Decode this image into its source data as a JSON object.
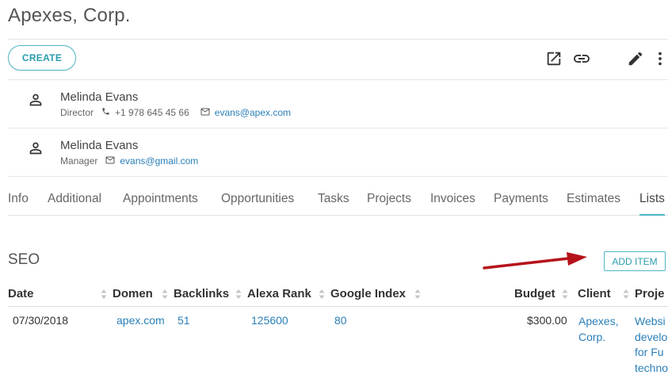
{
  "header": {
    "title": "Apexes, Corp."
  },
  "toolbar": {
    "create_label": "CREATE",
    "icons": [
      "open-external-icon",
      "link-icon",
      "edit-pencil-icon",
      "more-vert-icon"
    ]
  },
  "contacts": [
    {
      "name": "Melinda Evans",
      "role": "Director",
      "phone": "+1 978 645 45 66",
      "email": "evans@apex.com"
    },
    {
      "name": "Melinda Evans",
      "role": "Manager",
      "email": "evans@gmail.com"
    }
  ],
  "tabs": [
    "Info",
    "Additional",
    "Appointments",
    "Opportunities",
    "Tasks",
    "Projects",
    "Invoices",
    "Payments",
    "Estimates",
    "Lists"
  ],
  "active_tab": "Lists",
  "list": {
    "title": "SEO",
    "add_item_label": "ADD ITEM",
    "columns": [
      "Date",
      "Domen",
      "Backlinks",
      "Alexa Rank",
      "Google Index",
      "Budget",
      "Client",
      "Proje"
    ],
    "rows": [
      {
        "date": "07/30/2018",
        "domen": "apex.com",
        "backlinks": "51",
        "alexa_rank": "125600",
        "google_index": "80",
        "budget": "$300.00",
        "client_line1": "Apexes,",
        "client_line2": "Corp.",
        "project_lines": [
          "Websi",
          "develo",
          "for Fu",
          "techno"
        ]
      }
    ]
  },
  "colors": {
    "accent": "#4fb7c4",
    "link": "#2a7fb8",
    "arrow": "#b5121b"
  }
}
